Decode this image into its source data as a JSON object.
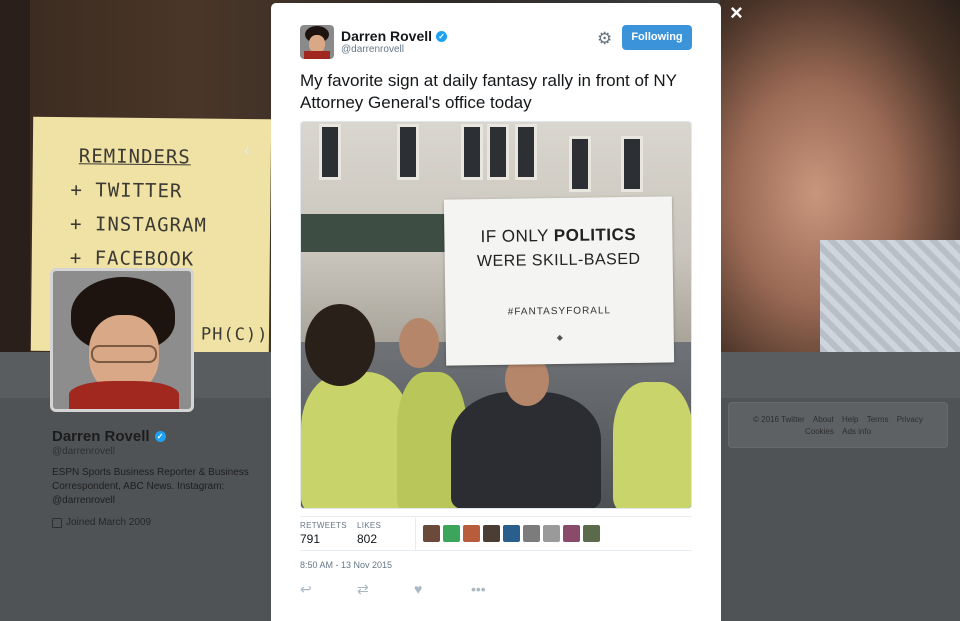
{
  "overlay": {
    "close_label": "×",
    "prev_label": "‹"
  },
  "background": {
    "sticky_note": {
      "lines": [
        "REMINDERS",
        "+ TWITTER",
        "+ INSTAGRAM",
        "+ FACEBOOK"
      ],
      "tail": "PH(C))"
    },
    "profile": {
      "name": "Darren Rovell",
      "handle": "@darrenrovell",
      "bio": "ESPN Sports Business Reporter & Business Correspondent, ABC News. Instagram: @darrenrovell",
      "joined": "Joined March 2009"
    },
    "footer_links": [
      "© 2016 Twitter",
      "About",
      "Help",
      "Terms",
      "Privacy",
      "Cookies",
      "Ads info"
    ]
  },
  "tweet": {
    "author_name": "Darren Rovell",
    "author_handle": "@darrenrovell",
    "follow_label": "Following",
    "text": "My favorite sign at daily fantasy rally in front of NY Attorney General's office today",
    "photo_sign": {
      "line1_pre": "IF ONLY ",
      "line1_bold": "POLITICS",
      "line2": "WERE SKILL-BASED",
      "hashtag": "#FANTASYFORALL"
    },
    "stats": {
      "retweets_label": "RETWEETS",
      "retweets_value": "791",
      "likes_label": "LIKES",
      "likes_value": "802"
    },
    "likers_colors": [
      "#6b4a3a",
      "#3aa55b",
      "#b85c3c",
      "#4a3d33",
      "#2a5e8c",
      "#7c7c7c",
      "#9a9a9a",
      "#8a4a6a",
      "#5a6a4a"
    ],
    "timestamp": "8:50 AM - 13 Nov 2015",
    "colors": {
      "accent": "#3b94d9",
      "verified": "#1da1f2",
      "muted": "#657786"
    }
  }
}
